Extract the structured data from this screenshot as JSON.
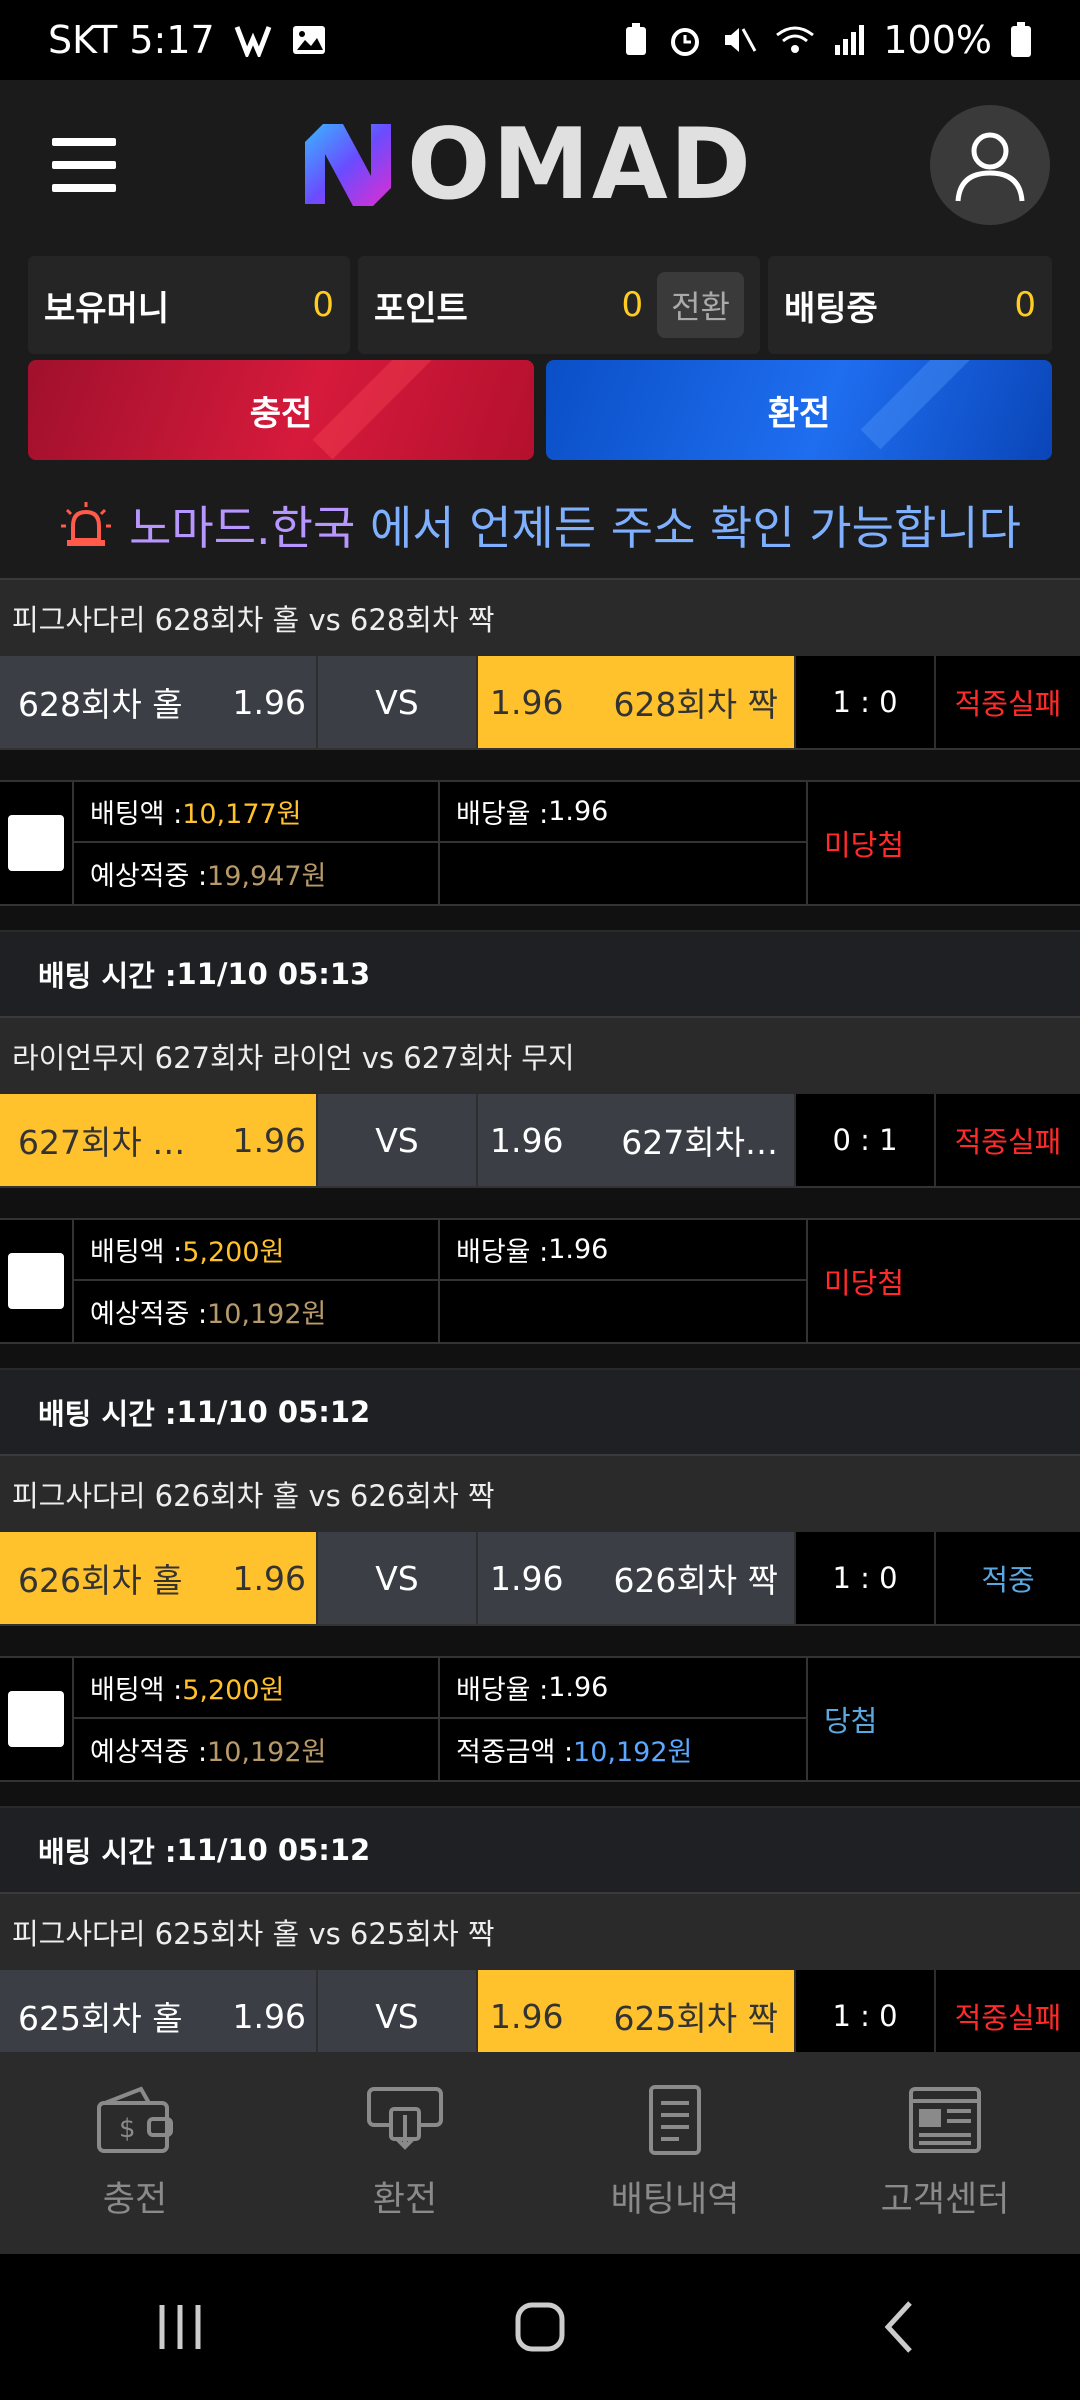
{
  "status_bar": {
    "carrier_time": "SKT 5:17",
    "battery": "100%"
  },
  "header": {
    "logo_text": "OMAD",
    "logo_mark": "N"
  },
  "balances": [
    {
      "label": "보유머니",
      "value": "0"
    },
    {
      "label": "포인트",
      "value": "0",
      "action": "전환"
    },
    {
      "label": "배팅중",
      "value": "0"
    }
  ],
  "actions": {
    "charge": "충전",
    "exchange": "환전"
  },
  "notice": {
    "site": "노마드.한국",
    "text": "에서 언제든 주소 확인 가능합니다"
  },
  "games": [
    {
      "title": "피그사다리 628회차 홀  vs  628회차 짝",
      "left_team": "628회차 홀",
      "left_odds": "1.96",
      "vs": "VS",
      "right_odds": "1.96",
      "right_team": "628회차 짝",
      "selected": "right",
      "score": "1 : 0",
      "result": "적중실패",
      "bet_label": "배팅액 : ",
      "bet_amount": "10,177원",
      "rate_label": "배당율 : ",
      "rate": "1.96",
      "expected_label": "예상적중 : ",
      "expected": "19,947원",
      "win_label": "",
      "win_amount": "",
      "status": "미당첨",
      "time_label": "배팅 시간 : ",
      "time": "11/10 05:13"
    },
    {
      "title": "라이언무지 627회차 라이언  vs  627회차 무지",
      "left_team": "627회차 …",
      "left_odds": "1.96",
      "vs": "VS",
      "right_odds": "1.96",
      "right_team": "627회차…",
      "selected": "left",
      "score": "0 : 1",
      "result": "적중실패",
      "bet_label": "배팅액 : ",
      "bet_amount": "5,200원",
      "rate_label": "배당율 : ",
      "rate": "1.96",
      "expected_label": "예상적중 : ",
      "expected": "10,192원",
      "win_label": "",
      "win_amount": "",
      "status": "미당첨",
      "time_label": "배팅 시간 : ",
      "time": "11/10 05:12"
    },
    {
      "title": "피그사다리 626회차 홀  vs  626회차 짝",
      "left_team": "626회차 홀",
      "left_odds": "1.96",
      "vs": "VS",
      "right_odds": "1.96",
      "right_team": "626회차 짝",
      "selected": "left",
      "score": "1 : 0",
      "result": "적중",
      "bet_label": "배팅액 : ",
      "bet_amount": "5,200원",
      "rate_label": "배당율 : ",
      "rate": "1.96",
      "expected_label": "예상적중 : ",
      "expected": "10,192원",
      "win_label": "적중금액 : ",
      "win_amount": "10,192원",
      "status": "당첨",
      "time_label": "배팅 시간 : ",
      "time": "11/10 05:12"
    },
    {
      "title": "피그사다리 625회차 홀  vs  625회차 짝",
      "left_team": "625회차 홀",
      "left_odds": "1.96",
      "vs": "VS",
      "right_odds": "1.96",
      "right_team": "625회차 짝",
      "selected": "right",
      "score": "1 : 0",
      "result": "적중실패"
    }
  ],
  "bottom_nav": [
    {
      "label": "충전",
      "icon": "wallet-icon"
    },
    {
      "label": "환전",
      "icon": "atm-withdraw-icon"
    },
    {
      "label": "배팅내역",
      "icon": "document-icon"
    },
    {
      "label": "고객센터",
      "icon": "news-icon"
    }
  ],
  "colors": {
    "selected": "#ffc22c",
    "fail": "#ff2a2a",
    "win": "#5aa8e0",
    "charge": "#d61a3c",
    "exchange": "#1f6ef0"
  }
}
